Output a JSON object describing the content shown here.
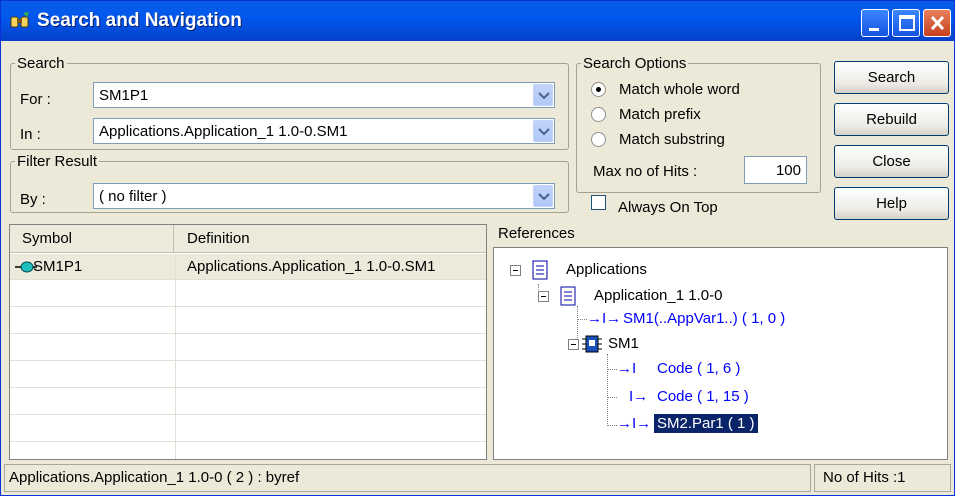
{
  "window": {
    "title": "Search and Navigation"
  },
  "search": {
    "legend": "Search",
    "for_label": "For :",
    "for_value": "SM1P1",
    "in_label": "In :",
    "in_value": "Applications.Application_1 1.0-0.SM1"
  },
  "filter": {
    "legend": "Filter Result",
    "by_label": "By :",
    "by_value": "( no filter )"
  },
  "options": {
    "legend": "Search Options",
    "radios": [
      {
        "label": "Match whole word",
        "selected": true
      },
      {
        "label": "Match prefix",
        "selected": false
      },
      {
        "label": "Match substring",
        "selected": false
      }
    ],
    "max_hits_label": "Max no of Hits :",
    "max_hits_value": "100",
    "always_on_top_label": "Always On Top",
    "always_on_top_checked": false
  },
  "buttons": {
    "search": "Search",
    "rebuild": "Rebuild",
    "close": "Close",
    "help": "Help"
  },
  "results": {
    "columns": [
      "Symbol",
      "Definition"
    ],
    "rows": [
      {
        "symbol": "SM1P1",
        "definition": "Applications.Application_1 1.0-0.SM1"
      }
    ]
  },
  "references": {
    "title": "References",
    "tree": [
      {
        "label": "Applications"
      },
      {
        "label": "Application_1 1.0-0"
      },
      {
        "label": "SM1(..AppVar1..) ( 1, 0 )"
      },
      {
        "label": "SM1"
      },
      {
        "label": "Code ( 1, 6 )"
      },
      {
        "label": "Code ( 1, 15 )"
      },
      {
        "label": "SM2.Par1 ( 1 )"
      }
    ]
  },
  "status": {
    "left": "Applications.Application_1 1.0-0 ( 2 ) : byref",
    "right": "No of Hits :1"
  },
  "colors": {
    "title_bar": "#0058ee",
    "link": "#0000ff",
    "selection": "#0a246a"
  }
}
